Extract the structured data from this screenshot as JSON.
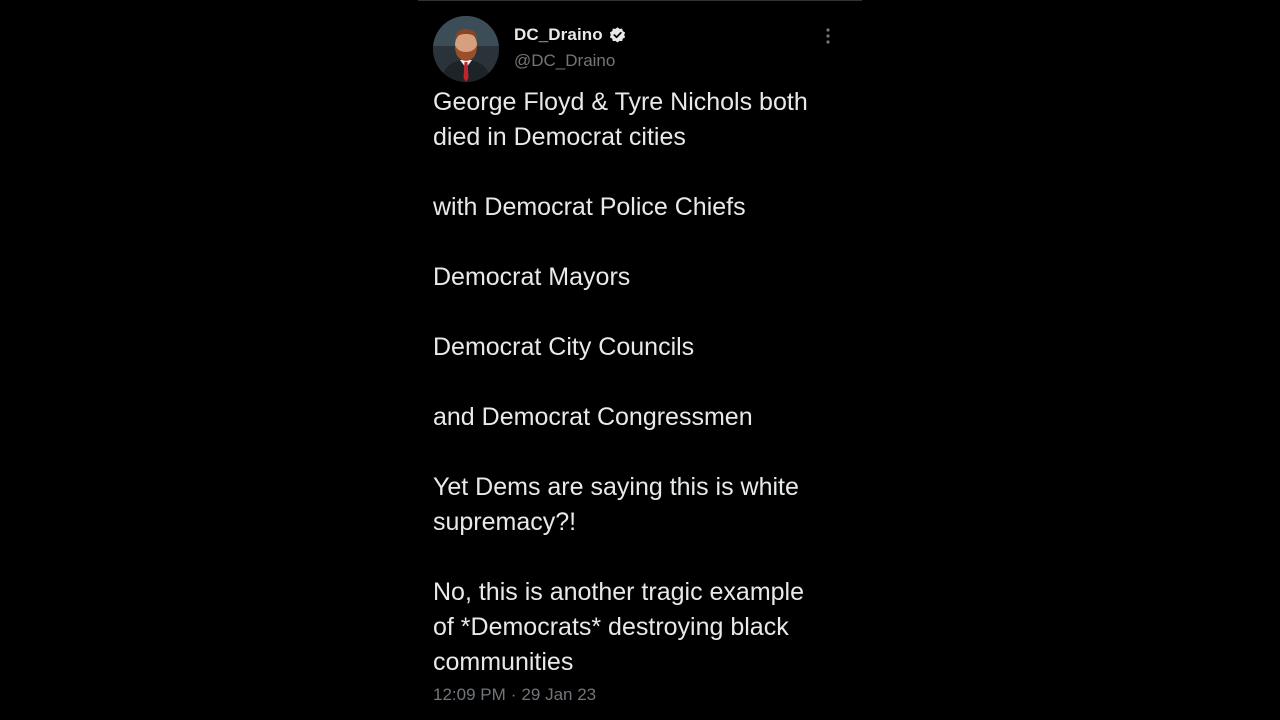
{
  "tweet": {
    "display_name": "DC_Draino",
    "handle": "@DC_Draino",
    "verified_icon": "verified-badge-icon",
    "more_icon": "more-options-icon",
    "text": "George Floyd & Tyre Nichols both\ndied in Democrat cities\n\nwith Democrat Police Chiefs\n\nDemocrat Mayors\n\nDemocrat City Councils\n\nand Democrat Congressmen\n\nYet Dems are saying this is white\nsupremacy?!\n\nNo, this is another tragic example\nof *Democrats* destroying black\ncommunities",
    "time": "12:09 PM",
    "separator": "·",
    "date": "29 Jan 23"
  },
  "colors": {
    "background": "#000000",
    "primary_text": "#e7e9ea",
    "secondary_text": "#71767b"
  }
}
